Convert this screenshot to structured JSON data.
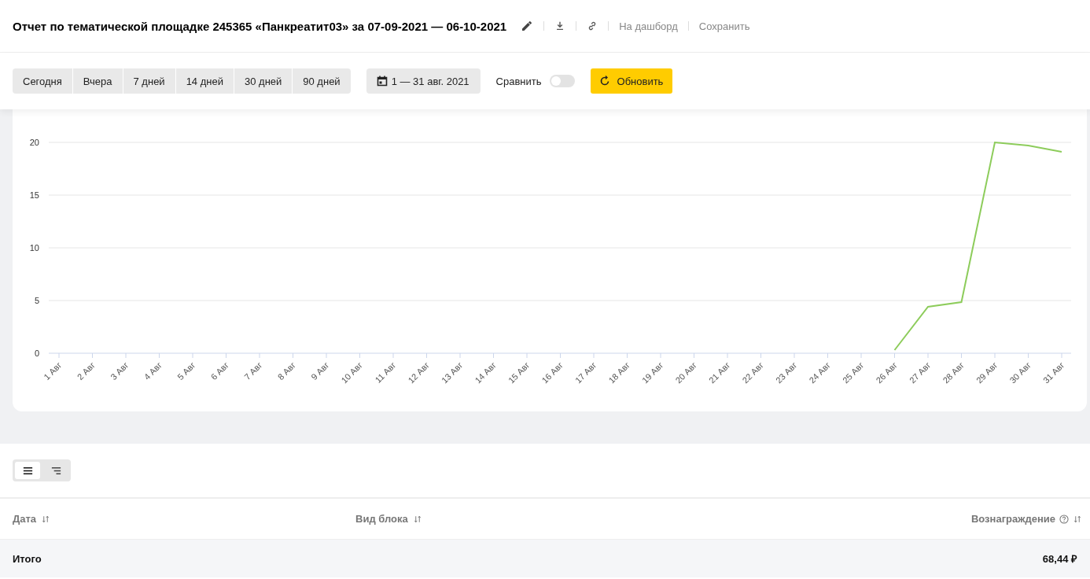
{
  "header": {
    "title": "Отчет по тематической площадке 245365 «Панкреатит03» за 07-09-2021 — 06-10-2021",
    "actions": [
      {
        "kind": "edit"
      },
      {
        "kind": "download"
      },
      {
        "kind": "link"
      },
      {
        "kind": "text",
        "label": "На дашборд"
      },
      {
        "kind": "text",
        "label": "Сохранить"
      }
    ]
  },
  "toolbar": {
    "periods": [
      {
        "label": "Сегодня",
        "selected": false
      },
      {
        "label": "Вчера",
        "selected": false
      },
      {
        "label": "7 дней",
        "selected": false
      },
      {
        "label": "14 дней",
        "selected": false
      },
      {
        "label": "30 дней",
        "selected": false
      },
      {
        "label": "90 дней",
        "selected": false
      }
    ],
    "date_range": "1 — 31 авг. 2021",
    "compare": {
      "label": "Сравнить",
      "on": false
    },
    "refresh": "Обновить"
  },
  "chart": {
    "chart_data": {
      "type": "line",
      "categories": [
        "1 Авг",
        "2 Авг",
        "3 Авг",
        "4 Авг",
        "5 Авг",
        "6 Авг",
        "7 Авг",
        "8 Авг",
        "9 Авг",
        "10 Авг",
        "11 Авг",
        "12 Авг",
        "13 Авг",
        "14 Авг",
        "15 Авг",
        "16 Авг",
        "17 Авг",
        "18 Авг",
        "19 Авг",
        "20 Авг",
        "21 Авг",
        "22 Авг",
        "23 Авг",
        "24 Авг",
        "25 Авг",
        "26 Авг",
        "27 Авг",
        "28 Авг",
        "29 Авг",
        "30 Авг",
        "31 Авг"
      ],
      "series": [
        {
          "color": "#8dcc5b",
          "values": [
            null,
            null,
            null,
            null,
            null,
            null,
            null,
            null,
            null,
            null,
            null,
            null,
            null,
            null,
            null,
            null,
            null,
            null,
            null,
            null,
            null,
            null,
            null,
            null,
            null,
            0.3,
            4.4,
            4.85,
            20,
            19.7,
            19.1
          ]
        }
      ],
      "ylim": [
        0,
        20
      ],
      "yticks": [
        0,
        5,
        10,
        15,
        20
      ],
      "grid": true
    }
  },
  "view_switch": [
    {
      "kind": "flat",
      "selected": true
    },
    {
      "kind": "tree",
      "selected": false
    }
  ],
  "table": {
    "columns": [
      {
        "label": "Дата",
        "help": false
      },
      {
        "label": "Вид блока",
        "help": false
      },
      {
        "label": "Вознаграждение",
        "help": true
      }
    ],
    "total": {
      "label": "Итого",
      "reward": "68,44 ₽"
    }
  }
}
